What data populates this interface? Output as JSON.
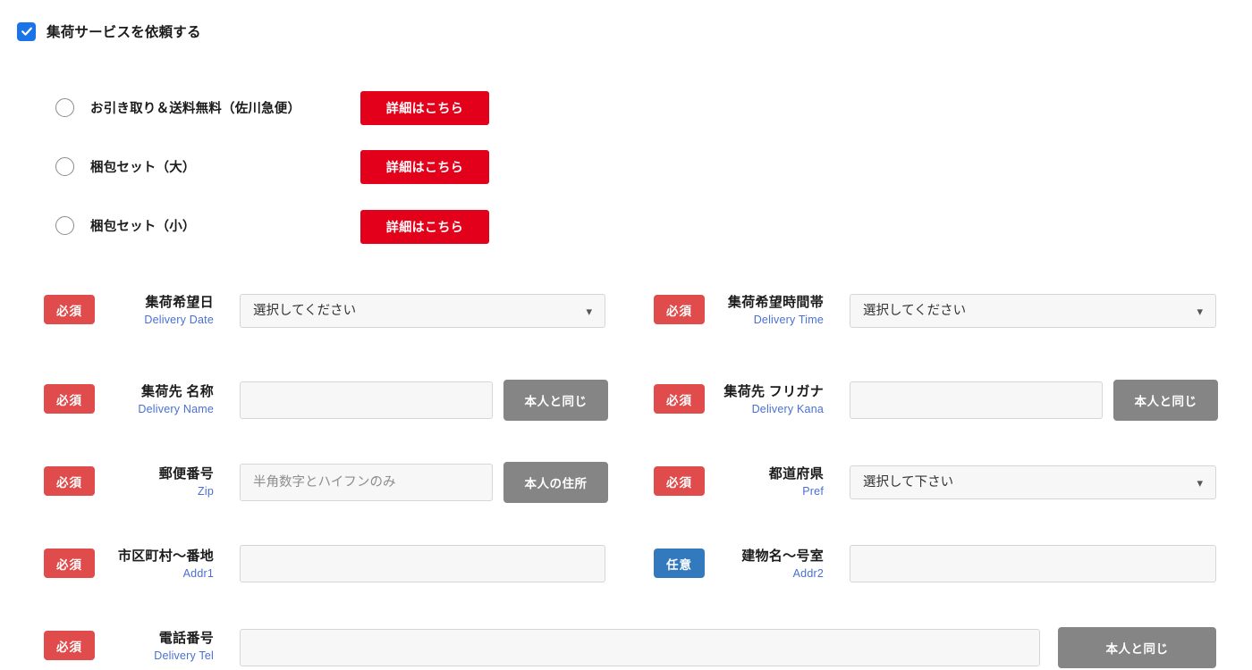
{
  "pickup": {
    "checkbox_label": "集荷サービスを依頼する",
    "checked": true,
    "accent_color": "#1a73e8"
  },
  "options": {
    "detail_button_label": "詳細はこちら",
    "detail_button_color": "#e2001a",
    "items": [
      {
        "label": "お引き取り＆送料無料（佐川急便）",
        "selected": false
      },
      {
        "label": "梱包セット（大）",
        "selected": false
      },
      {
        "label": "梱包セット（小）",
        "selected": false
      }
    ]
  },
  "badges": {
    "required": "必須",
    "optional": "任意",
    "required_color": "#e04b4b",
    "optional_color": "#3279bd"
  },
  "buttons": {
    "same_as_self": "本人と同じ",
    "same_address": "本人の住所",
    "gray_color": "#858585"
  },
  "fields": {
    "delivery_date": {
      "badge": "必須",
      "label_ja": "集荷希望日",
      "label_en": "Delivery Date",
      "type": "select",
      "value": "選択してください"
    },
    "delivery_time": {
      "badge": "必須",
      "label_ja": "集荷希望時間帯",
      "label_en": "Delivery Time",
      "type": "select",
      "value": "選択してください"
    },
    "delivery_name": {
      "badge": "必須",
      "label_ja": "集荷先 名称",
      "label_en": "Delivery Name",
      "type": "text",
      "value": "",
      "placeholder": "",
      "button": "本人と同じ"
    },
    "delivery_kana": {
      "badge": "必須",
      "label_ja": "集荷先 フリガナ",
      "label_en": "Delivery Kana",
      "type": "text",
      "value": "",
      "placeholder": "",
      "button": "本人と同じ"
    },
    "zip": {
      "badge": "必須",
      "label_ja": "郵便番号",
      "label_en": "Zip",
      "type": "text",
      "value": "",
      "placeholder": "半角数字とハイフンのみ",
      "button": "本人の住所"
    },
    "pref": {
      "badge": "必須",
      "label_ja": "都道府県",
      "label_en": "Pref",
      "type": "select",
      "value": "選択して下さい"
    },
    "addr1": {
      "badge": "必須",
      "label_ja": "市区町村〜番地",
      "label_en": "Addr1",
      "type": "text",
      "value": "",
      "placeholder": ""
    },
    "addr2": {
      "badge": "任意",
      "label_ja": "建物名〜号室",
      "label_en": "Addr2",
      "type": "text",
      "value": "",
      "placeholder": ""
    },
    "delivery_tel": {
      "badge": "必須",
      "label_ja": "電話番号",
      "label_en": "Delivery Tel",
      "type": "text",
      "value": "",
      "placeholder": "",
      "button": "本人と同じ"
    }
  }
}
